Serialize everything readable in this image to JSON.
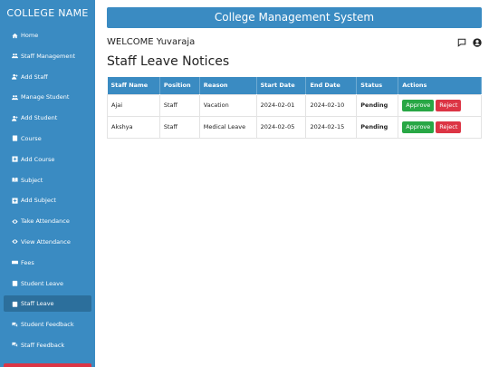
{
  "sidebar": {
    "brand": "COLLEGE NAME",
    "items": [
      {
        "label": "Home",
        "icon": "home-icon"
      },
      {
        "label": "Staff Management",
        "icon": "users-icon"
      },
      {
        "label": "Add Staff",
        "icon": "user-plus-icon"
      },
      {
        "label": "Manage Student",
        "icon": "users-icon"
      },
      {
        "label": "Add Student",
        "icon": "user-plus-icon"
      },
      {
        "label": "Course",
        "icon": "book-icon"
      },
      {
        "label": "Add Course",
        "icon": "plus-square-icon"
      },
      {
        "label": "Subject",
        "icon": "open-book-icon"
      },
      {
        "label": "Add Subject",
        "icon": "plus-square-icon"
      },
      {
        "label": "Take Attendance",
        "icon": "eye-icon"
      },
      {
        "label": "View Attendance",
        "icon": "eye-icon"
      },
      {
        "label": "Fees",
        "icon": "money-icon"
      },
      {
        "label": "Student Leave",
        "icon": "calendar-icon"
      },
      {
        "label": "Staff Leave",
        "icon": "calendar-icon"
      },
      {
        "label": "Student Feedback",
        "icon": "comments-icon"
      },
      {
        "label": "Staff Feedback",
        "icon": "comments-icon"
      }
    ],
    "active_index": 13
  },
  "header": {
    "title": "College Management System"
  },
  "welcome": {
    "text": "WELCOME Yuvaraja"
  },
  "page": {
    "title": "Staff Leave Notices"
  },
  "table": {
    "columns": [
      "Staff Name",
      "Position",
      "Reason",
      "Start Date",
      "End Date",
      "Status",
      "Actions"
    ],
    "rows": [
      {
        "name": "Ajai",
        "position": "Staff",
        "reason": "Vacation",
        "start": "2024-02-01",
        "end": "2024-02-10",
        "status": "Pending"
      },
      {
        "name": "Akshya",
        "position": "Staff",
        "reason": "Medical Leave",
        "start": "2024-02-05",
        "end": "2024-02-15",
        "status": "Pending"
      }
    ],
    "approve_label": "Approve",
    "reject_label": "Reject"
  },
  "colors": {
    "primary": "#3a8bc2",
    "approve": "#28a745",
    "reject": "#dc3545"
  }
}
